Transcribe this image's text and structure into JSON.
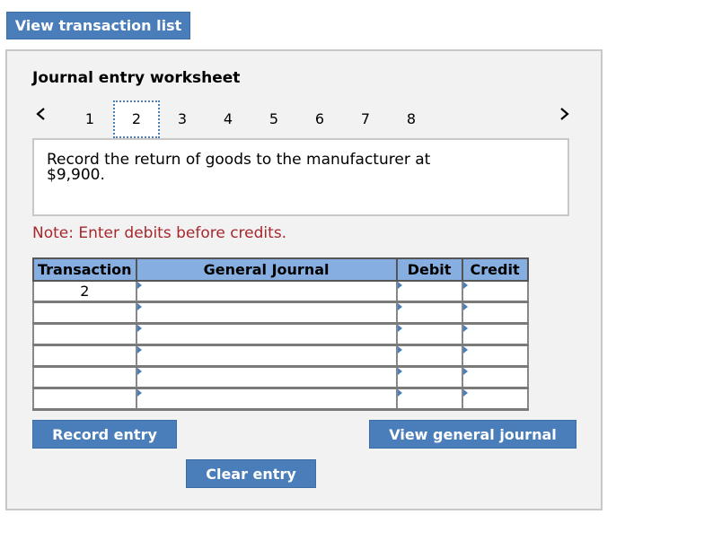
{
  "top_button": "View transaction list",
  "worksheet": {
    "title": "Journal entry worksheet",
    "prev_icon": "chevron-left-icon",
    "next_icon": "chevron-right-icon",
    "pages": [
      "1",
      "2",
      "3",
      "4",
      "5",
      "6",
      "7",
      "8"
    ],
    "active_page": "2",
    "description": "Record the return of goods to the manufacturer at $9,900.",
    "note": "Note: Enter debits before credits.",
    "table": {
      "headers": [
        "Transaction",
        "General Journal",
        "Debit",
        "Credit"
      ],
      "rows": [
        {
          "transaction": "2",
          "account": "",
          "debit": "",
          "credit": ""
        },
        {
          "transaction": "",
          "account": "",
          "debit": "",
          "credit": ""
        },
        {
          "transaction": "",
          "account": "",
          "debit": "",
          "credit": ""
        },
        {
          "transaction": "",
          "account": "",
          "debit": "",
          "credit": ""
        },
        {
          "transaction": "",
          "account": "",
          "debit": "",
          "credit": ""
        },
        {
          "transaction": "",
          "account": "",
          "debit": "",
          "credit": ""
        }
      ]
    },
    "buttons": {
      "record": "Record entry",
      "view_journal": "View general journal",
      "clear": "Clear entry"
    }
  }
}
